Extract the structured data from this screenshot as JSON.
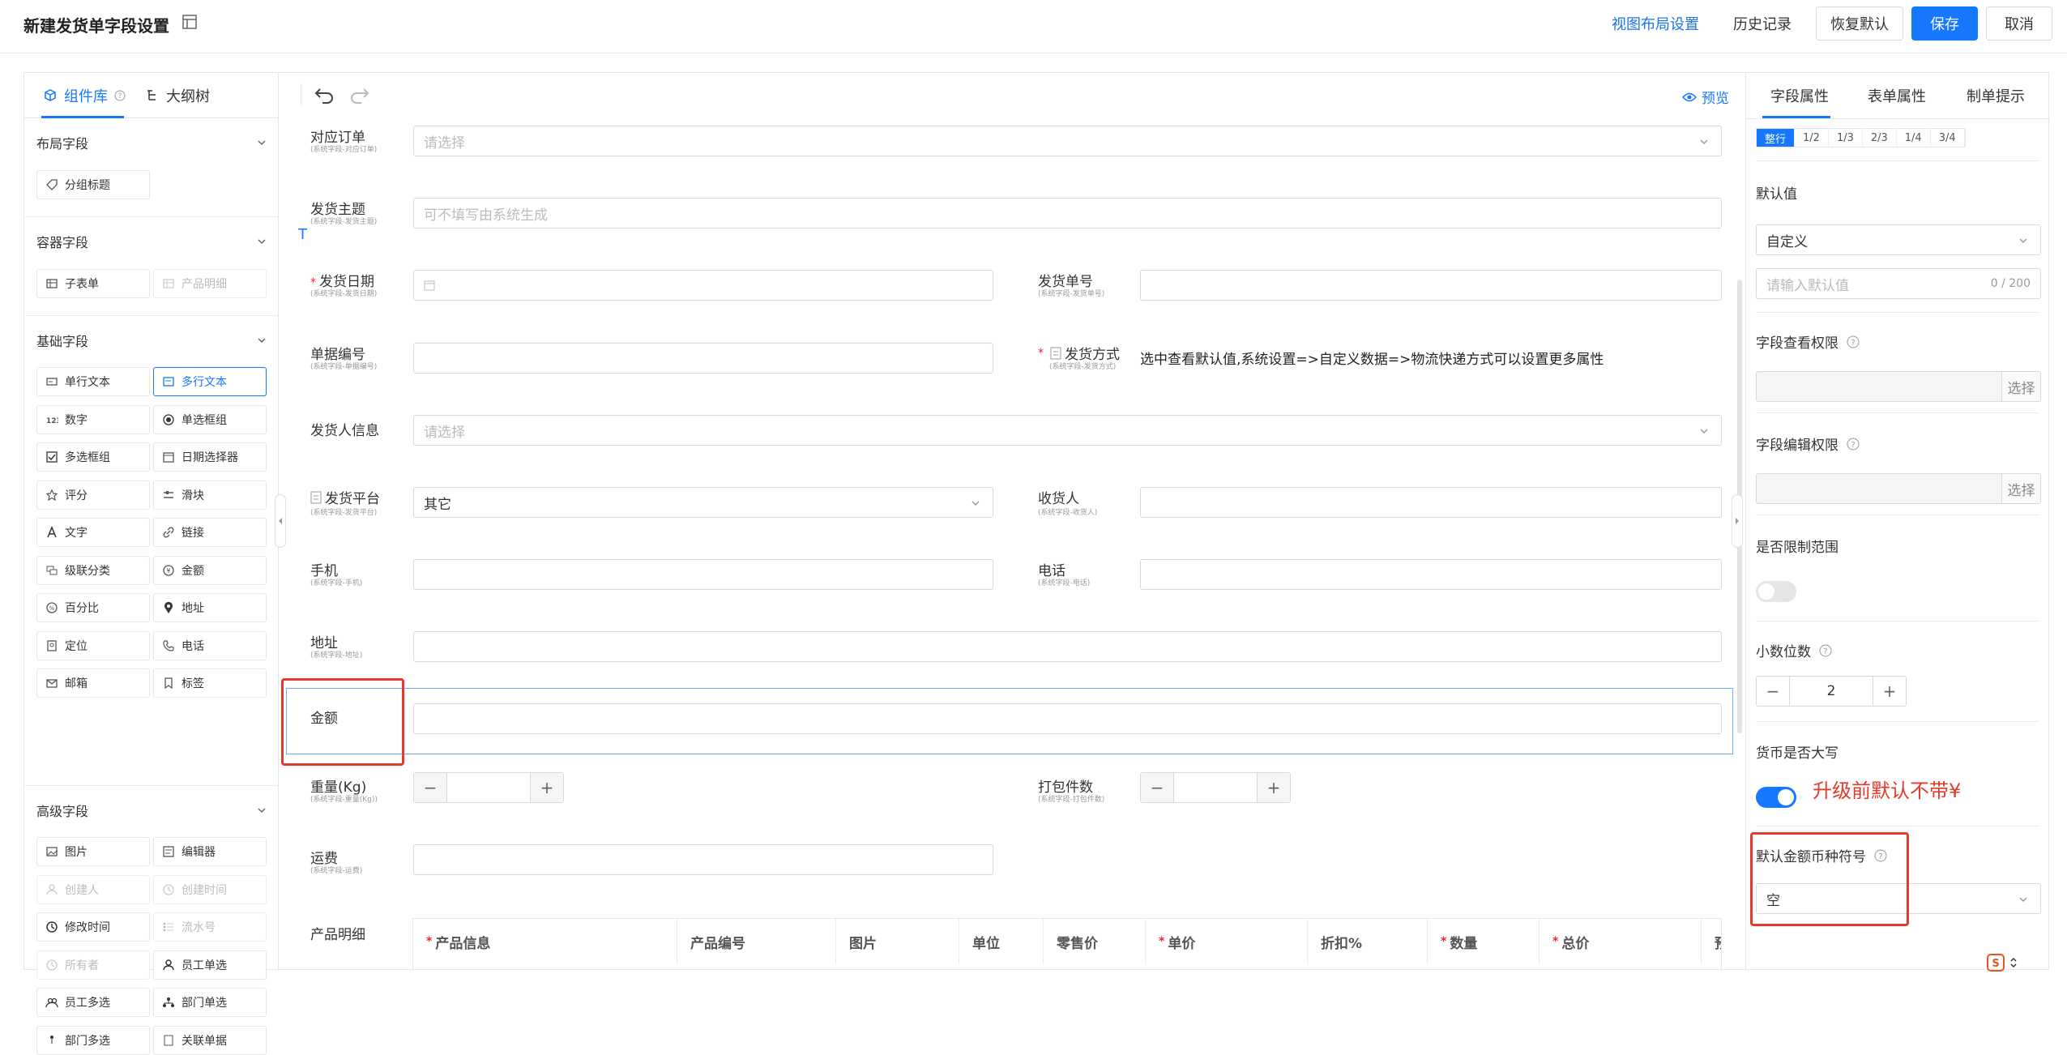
{
  "header": {
    "title": "新建发货单字段设置",
    "actions": {
      "view_layout": "视图布局设置",
      "history": "历史记录",
      "restore": "恢复默认",
      "save": "保存",
      "cancel": "取消"
    }
  },
  "left_panel": {
    "tabs": {
      "components": "组件库",
      "outline": "大纲树"
    },
    "groups": {
      "layout": {
        "title": "布局字段",
        "items": [
          "分组标题"
        ]
      },
      "container": {
        "title": "容器字段",
        "items": [
          "子表单",
          "产品明细"
        ]
      },
      "basic": {
        "title": "基础字段",
        "items": [
          "单行文本",
          "多行文本",
          "数字",
          "单选框组",
          "多选框组",
          "日期选择器",
          "评分",
          "滑块",
          "文字",
          "链接",
          "级联分类",
          "金额",
          "百分比",
          "地址",
          "定位",
          "电话",
          "邮箱",
          "标签"
        ]
      },
      "advanced": {
        "title": "高级字段",
        "items": [
          "图片",
          "编辑器",
          "创建人",
          "创建时间",
          "修改时间",
          "流水号",
          "所有者",
          "员工单选",
          "员工多选",
          "部门单选",
          "部门多选",
          "关联单据"
        ]
      }
    }
  },
  "center": {
    "preview": "预览",
    "fields": {
      "order": {
        "label": "对应订单",
        "sub": "(系统字段-对应订单)",
        "placeholder": "请选择"
      },
      "subject": {
        "label": "发货主题",
        "sub": "(系统字段-发货主题)",
        "placeholder": "可不填写由系统生成"
      },
      "ship_date": {
        "label": "发货日期",
        "sub": "(系统字段-发货日期)"
      },
      "ship_no": {
        "label": "发货单号",
        "sub": "(系统字段-发货单号)"
      },
      "doc_no": {
        "label": "单据编号",
        "sub": "(系统字段-单据编号)"
      },
      "ship_method": {
        "label": "发货方式",
        "sub": "(系统字段-发货方式)",
        "hint": "选中查看默认值,系统设置=>自定义数据=>物流快递方式可以设置更多属性"
      },
      "shipper": {
        "label": "发货人信息",
        "placeholder": "请选择"
      },
      "platform": {
        "label": "发货平台",
        "sub": "(系统字段-发货平台)",
        "value": "其它"
      },
      "receiver": {
        "label": "收货人",
        "sub": "(系统字段-收货人)"
      },
      "mobile": {
        "label": "手机",
        "sub": "(系统字段-手机)"
      },
      "phone": {
        "label": "电话",
        "sub": "(系统字段-电话)"
      },
      "address": {
        "label": "地址",
        "sub": "(系统字段-地址)"
      },
      "amount": {
        "label": "金额"
      },
      "weight": {
        "label": "重量(Kg)",
        "sub": "(系统字段-重量(Kg))"
      },
      "packages": {
        "label": "打包件数",
        "sub": "(系统字段-打包件数)"
      },
      "freight": {
        "label": "运费",
        "sub": "(系统字段-运费)"
      },
      "products": {
        "label": "产品明细"
      }
    },
    "product_table": {
      "columns": [
        {
          "label": "产品信息",
          "required": true
        },
        {
          "label": "产品编号",
          "required": false
        },
        {
          "label": "图片",
          "required": false
        },
        {
          "label": "单位",
          "required": false
        },
        {
          "label": "零售价",
          "required": false
        },
        {
          "label": "单价",
          "required": true
        },
        {
          "label": "折扣%",
          "required": false
        },
        {
          "label": "数量",
          "required": true
        },
        {
          "label": "总价",
          "required": true
        },
        {
          "label": "预",
          "required": false
        }
      ]
    }
  },
  "right_panel": {
    "tabs": {
      "field_props": "字段属性",
      "form_props": "表单属性",
      "tips": "制单提示"
    },
    "width_options": [
      "整行",
      "1/2",
      "1/3",
      "2/3",
      "1/4",
      "3/4"
    ],
    "width_selected": "整行",
    "default_value": {
      "label": "默认值",
      "mode": "自定义",
      "placeholder": "请输入默认值",
      "counter": "0 / 200"
    },
    "view_permission": {
      "label": "字段查看权限",
      "button": "选择"
    },
    "edit_permission": {
      "label": "字段编辑权限",
      "button": "选择"
    },
    "limit_range": {
      "label": "是否限制范围",
      "on": false
    },
    "decimals": {
      "label": "小数位数",
      "value": "2"
    },
    "uppercase": {
      "label": "货币是否大写",
      "on": true
    },
    "annotation": "升级前默认不带¥",
    "currency_symbol": {
      "label": "默认金额币种符号",
      "value": "空"
    }
  },
  "colors": {
    "accent": "#1677ff",
    "annotation_red": "#e43a2b"
  }
}
